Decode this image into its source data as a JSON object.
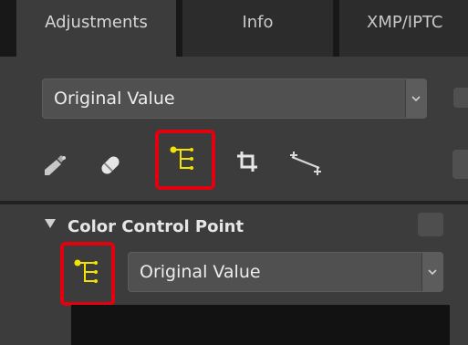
{
  "tabs": [
    {
      "label": "Adjustments"
    },
    {
      "label": "Info"
    },
    {
      "label": "XMP/IPTC"
    }
  ],
  "preset_select": {
    "value": "Original Value"
  },
  "toolbar": {
    "icons": [
      "dropper-brush-icon",
      "eraser-icon",
      "control-point-icon",
      "crop-icon",
      "straighten-icon"
    ],
    "highlight_color": "#e3000f"
  },
  "color_control_point": {
    "title": "Color Control Point",
    "select_value": "Original Value"
  },
  "colors": {
    "accent_yellow": "#f2e400",
    "panel_bg": "#3c3c3c",
    "tab_bar_bg": "#181818"
  }
}
